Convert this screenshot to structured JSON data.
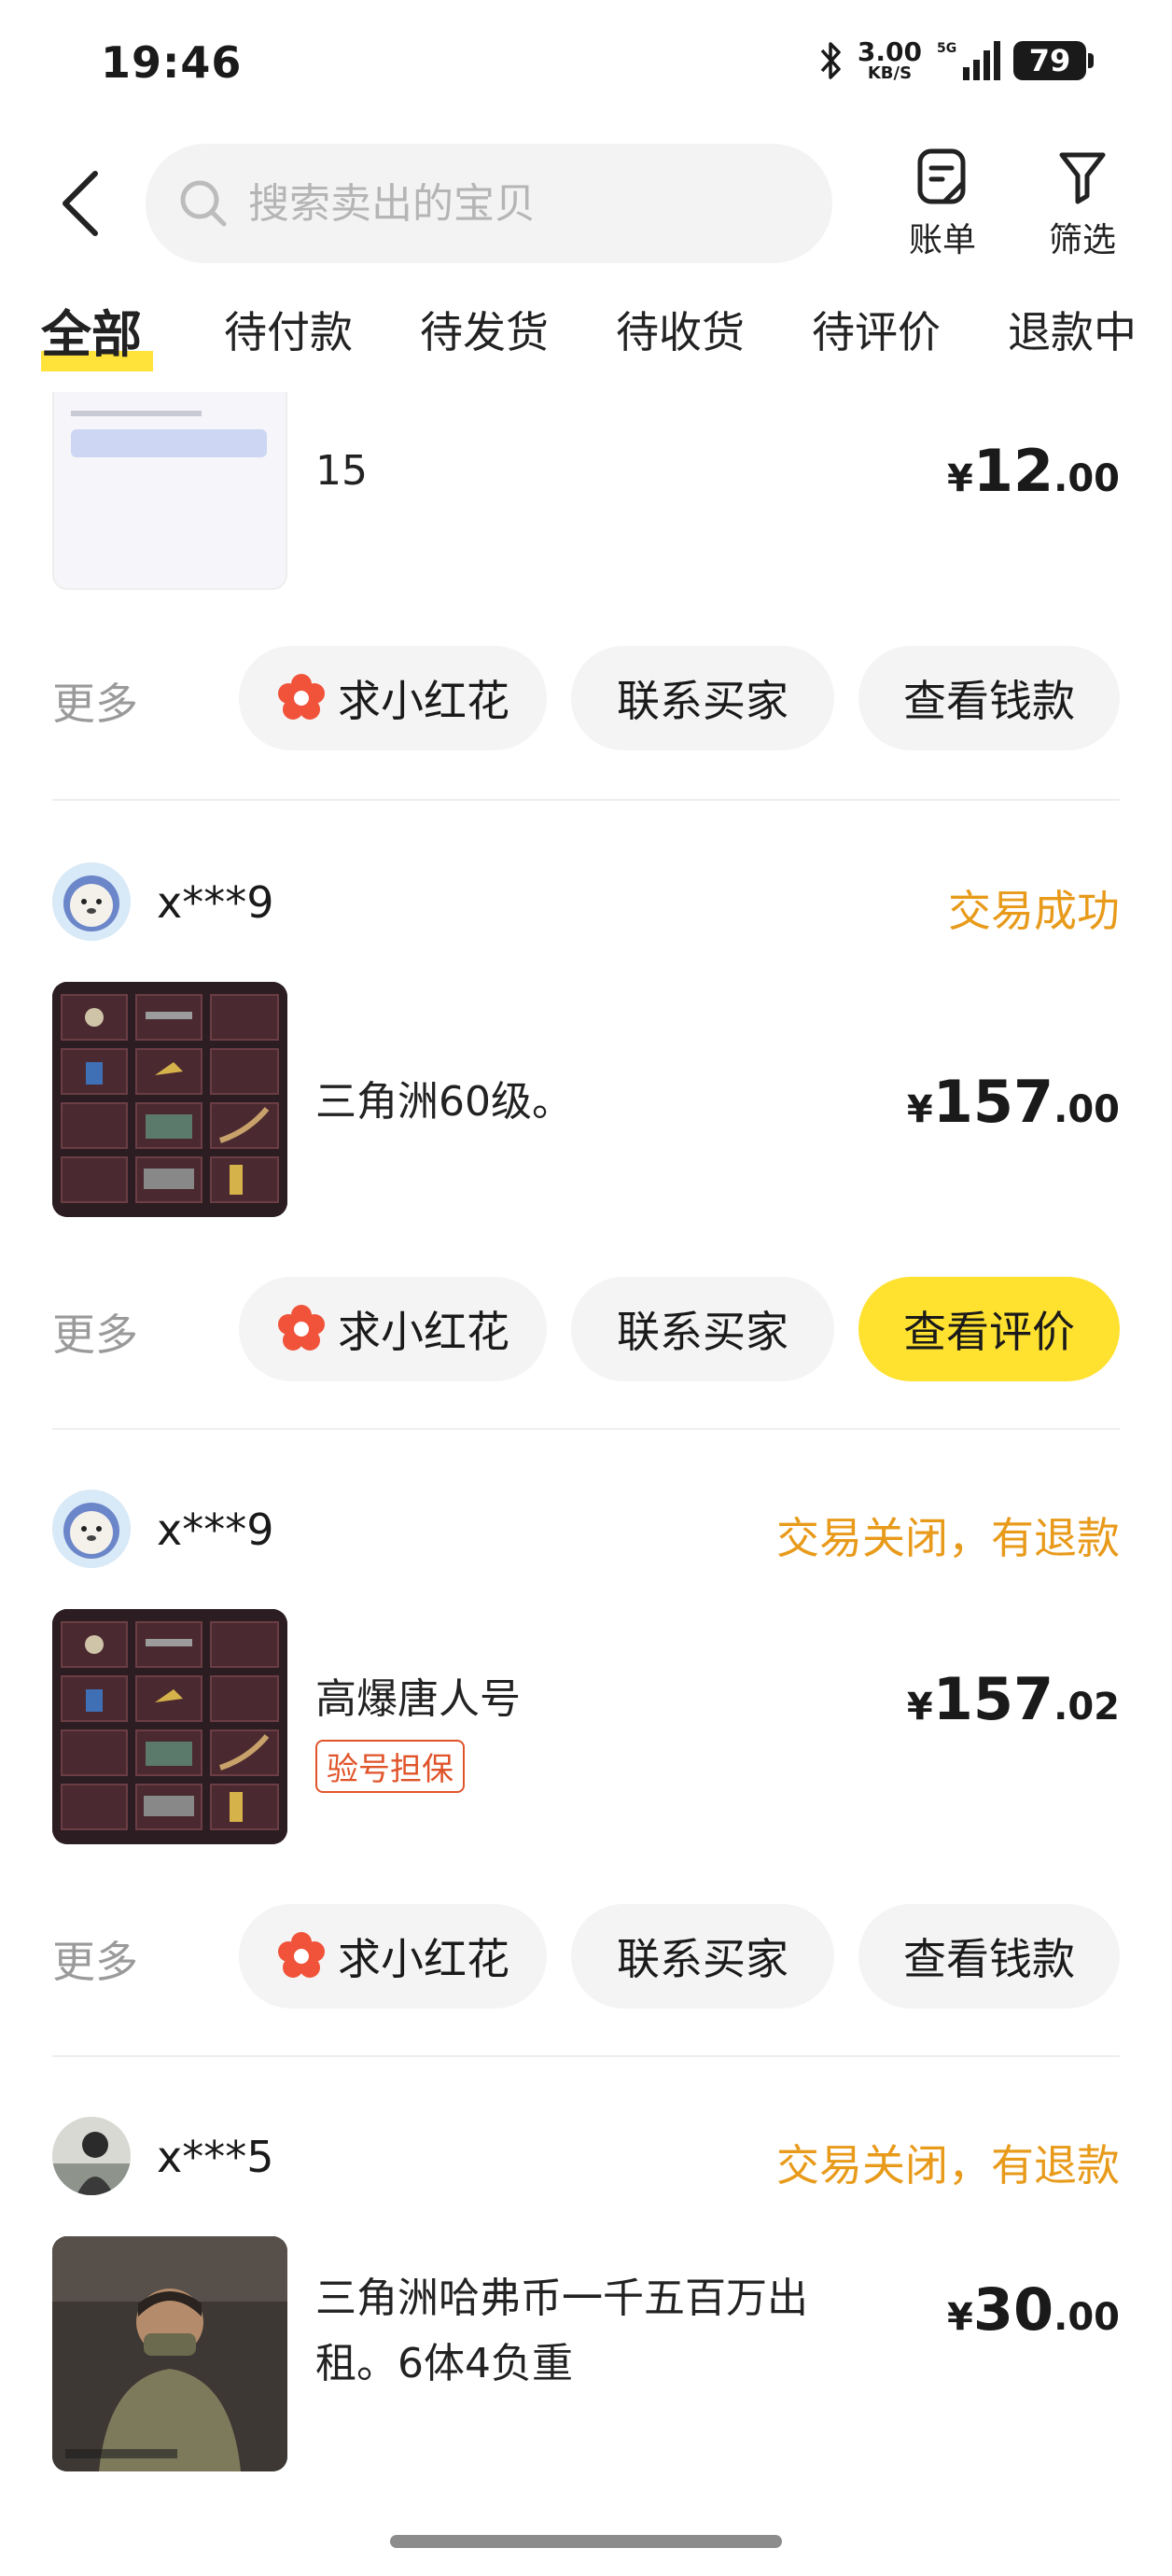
{
  "status_bar": {
    "time": "19:46",
    "net_speed_value": "3.00",
    "net_speed_unit": "KB/S",
    "network": "5G",
    "battery": "79"
  },
  "header": {
    "search_placeholder": "搜索卖出的宝贝",
    "bill_label": "账单",
    "filter_label": "筛选"
  },
  "tabs": [
    {
      "label": "全部",
      "active": true
    },
    {
      "label": "待付款",
      "active": false
    },
    {
      "label": "待发货",
      "active": false
    },
    {
      "label": "待收货",
      "active": false
    },
    {
      "label": "待评价",
      "active": false
    },
    {
      "label": "退款中",
      "active": false
    }
  ],
  "more_label": "更多",
  "orders": [
    {
      "buyer": "",
      "status": "",
      "title": "15",
      "price_currency": "¥",
      "price_int": "12",
      "price_dec": ".00",
      "actions": [
        "求小红花",
        "联系买家",
        "查看钱款"
      ],
      "primary_action": false
    },
    {
      "buyer": "x***9",
      "status": "交易成功",
      "title": "三角洲60级。",
      "price_currency": "¥",
      "price_int": "157",
      "price_dec": ".00",
      "actions": [
        "求小红花",
        "联系买家",
        "查看评价"
      ],
      "primary_action": true
    },
    {
      "buyer": "x***9",
      "status": "交易关闭，有退款",
      "title": "高爆唐人号",
      "tag": "验号担保",
      "price_currency": "¥",
      "price_int": "157",
      "price_dec": ".02",
      "actions": [
        "求小红花",
        "联系买家",
        "查看钱款"
      ],
      "primary_action": false
    },
    {
      "buyer": "x***5",
      "status": "交易关闭，有退款",
      "title": "三角洲哈弗币一千五百万出租。6体4负重",
      "price_currency": "¥",
      "price_int": "30",
      "price_dec": ".00"
    }
  ],
  "colors": {
    "accent_yellow": "#ffe12f",
    "status_orange": "#e89a1a",
    "tag_red": "#e0542a"
  }
}
